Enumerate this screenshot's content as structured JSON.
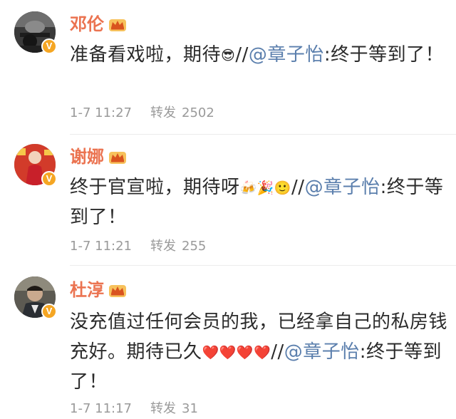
{
  "comments": [
    {
      "username": "邓伦",
      "text_before": "准备看戏啦，期待",
      "emojis": [
        "😎"
      ],
      "separator": "//",
      "mention": "@章子怡",
      "text_after": ":终于等到了！",
      "time": "1-7 11:27",
      "repost_label": "转发",
      "repost_count": "2502",
      "badges": [
        "verified-v-badge",
        "crown-icon"
      ]
    },
    {
      "username": "谢娜",
      "text_before": "终于官宣啦，期待呀",
      "emojis": [
        "🍻",
        "🎉",
        "🙂"
      ],
      "separator": "//",
      "mention": "@章子怡",
      "text_after": ":终于等到了！",
      "time": "1-7 11:21",
      "repost_label": "转发",
      "repost_count": "255",
      "badges": [
        "verified-v-badge",
        "crown-icon"
      ]
    },
    {
      "username": "杜淳",
      "text_before": "没充值过任何会员的我，已经拿自己的私房钱充好。期待已久",
      "emojis": [
        "❤️",
        "❤️",
        "❤️",
        "❤️"
      ],
      "separator": "//",
      "mention": "@章子怡",
      "text_after": ":终于等到了！",
      "time": "1-7 11:17",
      "repost_label": "转发",
      "repost_count": "31",
      "badges": [
        "verified-v-badge",
        "crown-icon"
      ]
    }
  ],
  "badge_v_char": "V",
  "colors": {
    "username": "#eb7350",
    "mention": "#5b7fad",
    "meta": "#9a9a9a",
    "body_text": "#2b2b2b",
    "verified_badge": "#f5a623",
    "crown": "#f0a32c"
  }
}
